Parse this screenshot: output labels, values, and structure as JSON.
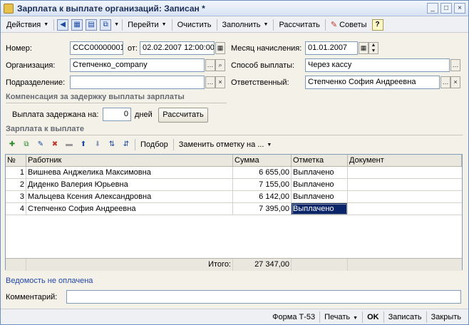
{
  "window": {
    "title": "Зарплата к выплате организаций: Записан *",
    "minimize": "_",
    "maximize": "□",
    "close": "×"
  },
  "toolbar": {
    "actions": "Действия",
    "goto": "Перейти",
    "clear": "Очистить",
    "fill": "Заполнить",
    "calculate": "Рассчитать",
    "tips": "Советы",
    "help": "?"
  },
  "form": {
    "number_label": "Номер:",
    "number_value": "ССС00000001",
    "date_label": "от:",
    "date_value": "02.02.2007 12:00:00",
    "month_label": "Месяц начисления:",
    "month_value": "01.01.2007",
    "org_label": "Организация:",
    "org_value": "Степченко_company",
    "pay_method_label": "Способ выплаты:",
    "pay_method_value": "Через кассу",
    "dept_label": "Подразделение:",
    "dept_value": "",
    "responsible_label": "Ответственный:",
    "responsible_value": "Степченко София Андреевна"
  },
  "compensation": {
    "title": "Компенсация за задержку выплаты зарплаты",
    "delay_label": "Выплата задержана на:",
    "delay_value": "0",
    "days_label": "дней",
    "calc_button": "Рассчитать"
  },
  "salary": {
    "title": "Зарплата к выплате",
    "selection_button": "Подбор",
    "replace_mark_button": "Заменить отметку на ..."
  },
  "table": {
    "columns": [
      "№",
      "Работник",
      "Сумма",
      "Отметка",
      "Документ"
    ],
    "rows": [
      {
        "n": "1",
        "employee": "Вишнева Анджелика Максимовна",
        "sum": "6 655,00",
        "mark": "Выплачено",
        "doc": ""
      },
      {
        "n": "2",
        "employee": "Диденко Валерия Юрьевна",
        "sum": "7 155,00",
        "mark": "Выплачено",
        "doc": ""
      },
      {
        "n": "3",
        "employee": "Мальцева Ксения Александровна",
        "sum": "6 142,00",
        "mark": "Выплачено",
        "doc": ""
      },
      {
        "n": "4",
        "employee": "Степченко София Андреевна",
        "sum": "7 395,00",
        "mark": "Выплачено",
        "doc": ""
      }
    ],
    "total_label": "Итого:",
    "total_value": "27 347,00"
  },
  "status_link": "Ведомость не оплачена",
  "comment_label": "Комментарий:",
  "comment_value": "",
  "bottom": {
    "form_t53": "Форма Т-53",
    "print": "Печать",
    "ok": "OK",
    "save": "Записать",
    "close": "Закрыть"
  }
}
